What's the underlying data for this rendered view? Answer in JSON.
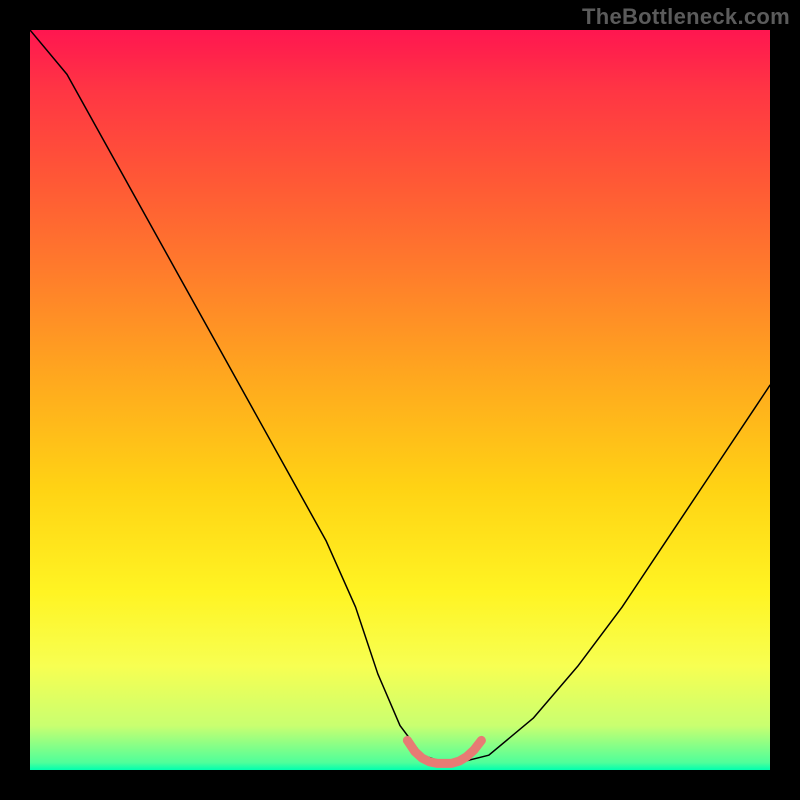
{
  "watermark": "TheBottleneck.com",
  "chart_data": {
    "type": "line",
    "title": "",
    "xlabel": "",
    "ylabel": "",
    "xlim": [
      0,
      100
    ],
    "ylim": [
      0,
      100
    ],
    "background_gradient": {
      "top_color": "#ff1650",
      "bottom_color": "#00ffb0",
      "note": "vertical gradient red→orange→yellow→green representing bottleneck severity"
    },
    "series": [
      {
        "name": "bottleneck-curve",
        "color": "#000000",
        "stroke_width": 1.5,
        "x": [
          0,
          5,
          10,
          15,
          20,
          25,
          30,
          35,
          40,
          44,
          47,
          50,
          53,
          56,
          58,
          62,
          68,
          74,
          80,
          86,
          92,
          98,
          100
        ],
        "y": [
          100,
          94,
          85,
          76,
          67,
          58,
          49,
          40,
          31,
          22,
          13,
          6,
          2,
          1,
          1,
          2,
          7,
          14,
          22,
          31,
          40,
          49,
          52
        ]
      },
      {
        "name": "optimal-zone-marker",
        "color": "#e77b74",
        "stroke_width": 9,
        "x": [
          51,
          52,
          53,
          54,
          55,
          56,
          57,
          58,
          59,
          60,
          61
        ],
        "y": [
          4,
          2.5,
          1.6,
          1.1,
          0.9,
          0.9,
          0.9,
          1.2,
          1.8,
          2.7,
          4
        ]
      }
    ],
    "annotations": []
  }
}
